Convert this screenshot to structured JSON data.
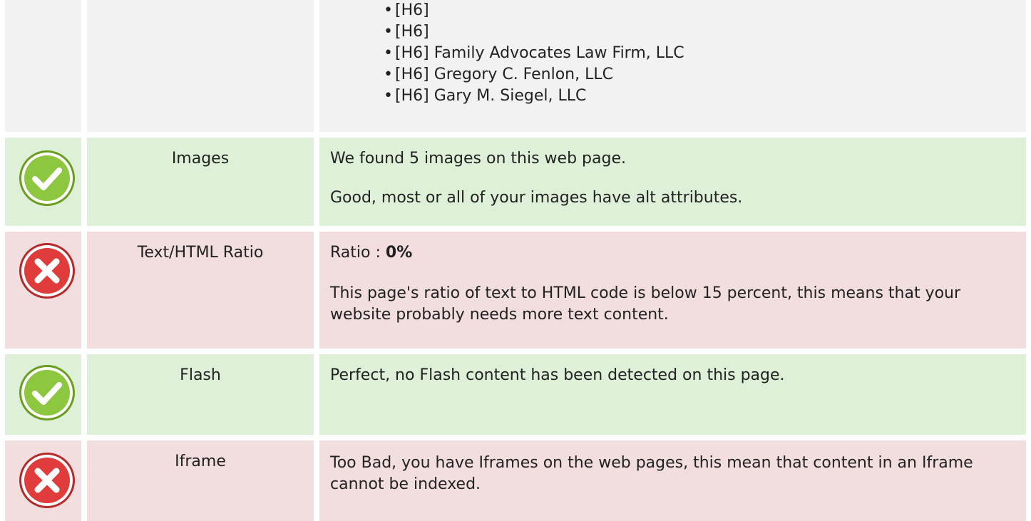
{
  "headings": {
    "h6_items": [
      "[H6]",
      "[H6]",
      "[H6] Family Advocates Law Firm, LLC",
      "[H6] Gregory C. Fenlon, LLC",
      "[H6] Gary M. Siegel, LLC"
    ]
  },
  "rows": [
    {
      "status": "good",
      "icon": "check-circle-icon",
      "label": "Images",
      "lines": [
        "We found 5 images on this web page.",
        "Good, most or all of your images have alt attributes."
      ]
    },
    {
      "status": "bad",
      "icon": "x-circle-icon",
      "label": "Text/HTML Ratio",
      "ratio_prefix": "Ratio : ",
      "ratio_value": "0%",
      "note": "This page's ratio of text to HTML code is below 15 percent, this means that your website probably needs more text content."
    },
    {
      "status": "good",
      "icon": "check-circle-icon",
      "label": "Flash",
      "note": "Perfect, no Flash content has been detected on this page."
    },
    {
      "status": "bad",
      "icon": "x-circle-icon",
      "label": "Iframe",
      "note": "Too Bad, you have Iframes on the web pages, this mean that content in an Iframe cannot be indexed."
    }
  ],
  "colors": {
    "good_bg": "#dff0d8",
    "bad_bg": "#f2dede",
    "neutral_bg": "#f2f2f2",
    "check_green": "#8dc63f",
    "x_red": "#e03c3c"
  }
}
